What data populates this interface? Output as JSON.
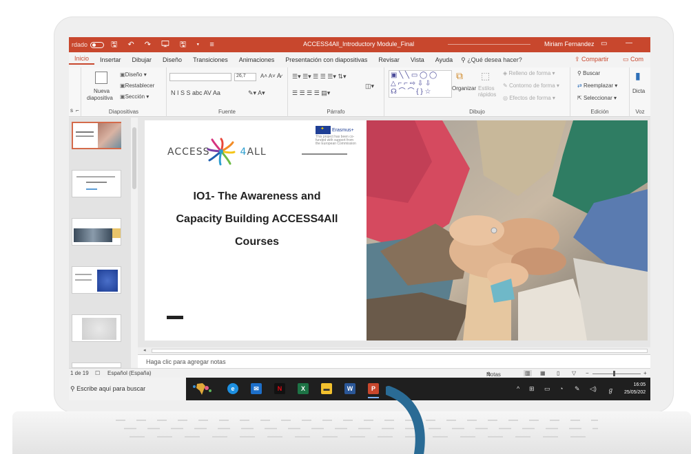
{
  "titlebar": {
    "autosave_label": "rdado",
    "quick_access": "🖫 ↶ ↷ 🖵 🖫 ▾ ≡",
    "doc_title": "ACCESS4All_Introductory Module_Final",
    "user_name": "Miriam Fernandez"
  },
  "tabs": {
    "items": [
      "Inicio",
      "Insertar",
      "Dibujar",
      "Diseño",
      "Transiciones",
      "Animaciones",
      "Presentación con diapositivas",
      "Revisar",
      "Vista",
      "Ayuda"
    ],
    "tell_me": "¿Qué desea hacer?",
    "share": "Compartir",
    "comment": "Com"
  },
  "ribbon": {
    "slides_group": {
      "label": "Diapositivas",
      "new_slide": "Nueva",
      "new_slide_2": "diapositiva",
      "layout": "Diseño",
      "reset": "Restablecer",
      "section": "Sección"
    },
    "font_group": {
      "label": "Fuente",
      "font_size": "26,7",
      "formatting": "N  I  S  S  abc  AV  Aa",
      "grow_shrink": "A˄ A˅"
    },
    "paragraph_group": {
      "label": "Párrafo"
    },
    "drawing_group": {
      "label": "Dibujo",
      "arrange": "Organizar",
      "quick_styles": "Estilos rápidos",
      "shape_fill": "Relleno de forma",
      "shape_outline": "Contorno de forma",
      "shape_effects": "Efectos de forma"
    },
    "editing_group": {
      "label": "Edición",
      "find": "Buscar",
      "replace": "Reemplazar",
      "select": "Seleccionar"
    },
    "voice_group": {
      "label": "Voz",
      "dictate": "Dicta"
    },
    "left_fragment": "s",
    "left_arrow": "⌐"
  },
  "slide": {
    "logo_left": "ACCESS",
    "logo_four": "4",
    "logo_right": "ALL",
    "erasmus_label": "Erasmus+",
    "erasmus_fine": "This project has been co-funded with support from the European Commission",
    "title_line_1": "IO1- The Awareness and",
    "title_line_2": "Capacity Building ACCESS4All",
    "title_line_3": "Courses"
  },
  "notes": {
    "placeholder": "Haga clic para agregar notas"
  },
  "statusbar": {
    "slide_counter": "1 de 19",
    "language": "Español (España)",
    "notes_label": "Notas"
  },
  "taskbar": {
    "search_placeholder": "Escribe aquí para buscar",
    "time": "16:05",
    "date": "25/05/202",
    "apps": [
      "edge",
      "mail",
      "netflix",
      "excel",
      "explorer",
      "word",
      "powerpoint"
    ]
  },
  "colors": {
    "ppt_accent": "#c8472d",
    "taskbar": "#1f1f1f",
    "arrow": "#2a6b95"
  }
}
